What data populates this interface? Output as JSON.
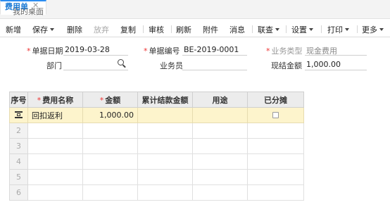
{
  "tabs": {
    "home": "我的桌面",
    "active": "费用单",
    "close": "✕"
  },
  "toolbar": {
    "new": "新增",
    "save": "保存",
    "delete": "删除",
    "discard": "放弃",
    "copy": "复制",
    "audit": "审核",
    "refresh": "刷新",
    "attach": "附件",
    "message": "消息",
    "linked": "联查",
    "settings": "设置",
    "print": "打印",
    "more": "更多"
  },
  "form": {
    "date_label": "单据日期",
    "date_value": "2019-03-28",
    "no_label": "单据编号",
    "no_value": "BE-2019-0001",
    "biztype_label": "业务类型",
    "biztype_value": "现金费用",
    "dept_label": "部门",
    "dept_value": "",
    "staff_label": "业务员",
    "staff_value": "",
    "cash_label": "现结金额",
    "cash_value": "1,000.00",
    "required_mark": "*"
  },
  "grid": {
    "headers": [
      "序号",
      "费用名称",
      "金额",
      "累计结款金额",
      "用途",
      "已分摊"
    ],
    "rows": [
      {
        "no": "",
        "name": "回扣返利",
        "amount": "1,000.00",
        "settled": "",
        "purpose": ""
      },
      {
        "no": "2",
        "name": "",
        "amount": "",
        "settled": "",
        "purpose": ""
      },
      {
        "no": "3",
        "name": "",
        "amount": "",
        "settled": "",
        "purpose": ""
      },
      {
        "no": "4",
        "name": "",
        "amount": "",
        "settled": "",
        "purpose": ""
      },
      {
        "no": "5",
        "name": "",
        "amount": "",
        "settled": "",
        "purpose": ""
      },
      {
        "no": "6",
        "name": "",
        "amount": "",
        "settled": "",
        "purpose": ""
      }
    ]
  }
}
